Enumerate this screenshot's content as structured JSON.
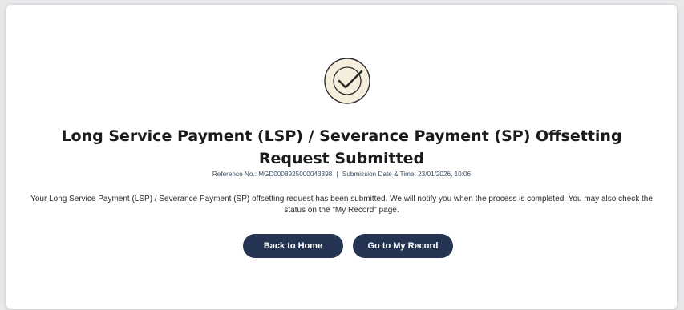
{
  "result": {
    "icon": "check-circle-icon",
    "colors": {
      "icon_fill": "#f6eedc",
      "icon_stroke": "#2b2b2b",
      "button_bg": "#243452",
      "button_text": "#ffffff"
    },
    "title": "Long Service Payment (LSP) / Severance Payment (SP) Offsetting Request Submitted",
    "reference_label": "Reference No.:",
    "reference_value": "MGD0008925000043398",
    "separator": "|",
    "submission_label": "Submission Date & Time:",
    "submission_value": "23/01/2026, 10:06",
    "message": "Your Long Service Payment (LSP) / Severance Payment (SP) offsetting request has been submitted. We will notify you when the process is completed. You may also check the status on the \"My Record\" page."
  },
  "actions": {
    "back_home_label": "Back to Home",
    "my_record_label": "Go to My Record"
  }
}
